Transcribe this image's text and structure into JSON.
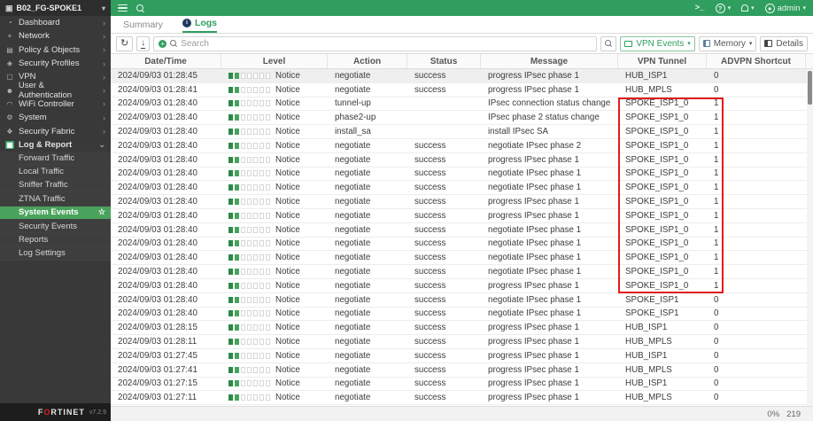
{
  "device": {
    "name": "B02_FG-SPOKE1"
  },
  "navbar": {
    "username": "admin",
    "help_icon": "?",
    "cli_icon": ">_"
  },
  "sidebar": {
    "items": [
      {
        "label": "Dashboard",
        "icon": "gauge-icon"
      },
      {
        "label": "Network",
        "icon": "network-icon"
      },
      {
        "label": "Policy & Objects",
        "icon": "policy-icon"
      },
      {
        "label": "Security Profiles",
        "icon": "shield-icon"
      },
      {
        "label": "VPN",
        "icon": "monitor-icon"
      },
      {
        "label": "User & Authentication",
        "icon": "user-icon"
      },
      {
        "label": "WiFi Controller",
        "icon": "wifi-icon"
      },
      {
        "label": "System",
        "icon": "gear-icon"
      },
      {
        "label": "Security Fabric",
        "icon": "fabric-icon"
      },
      {
        "label": "Log & Report",
        "icon": "chart-icon",
        "expanded": true
      }
    ],
    "log_report_children": [
      "Forward Traffic",
      "Local Traffic",
      "Sniffer Traffic",
      "ZTNA Traffic",
      "System Events",
      "Security Events",
      "Reports",
      "Log Settings"
    ],
    "selected_child": "System Events",
    "footer": {
      "brand_prefix": "F",
      "brand_o": "O",
      "brand_suffix": "RTINET",
      "version": "v7.2.9"
    }
  },
  "tabs": {
    "summary": "Summary",
    "logs": "Logs"
  },
  "toolbar": {
    "search_placeholder": "Search",
    "vpn_events_label": "VPN Events",
    "memory_label": "Memory",
    "details_label": "Details"
  },
  "table": {
    "columns": [
      "Date/Time",
      "Level",
      "Action",
      "Status",
      "Message",
      "VPN Tunnel",
      "ADVPN Shortcut"
    ],
    "level_segments_total": 7,
    "level_segments_filled": 2,
    "rows": [
      [
        "2024/09/03 01:28:45",
        "Notice",
        "negotiate",
        "success",
        "progress IPsec phase 1",
        "HUB_ISP1",
        "0"
      ],
      [
        "2024/09/03 01:28:41",
        "Notice",
        "negotiate",
        "success",
        "progress IPsec phase 1",
        "HUB_MPLS",
        "0"
      ],
      [
        "2024/09/03 01:28:40",
        "Notice",
        "tunnel-up",
        "",
        "IPsec connection status change",
        "SPOKE_ISP1_0",
        "1"
      ],
      [
        "2024/09/03 01:28:40",
        "Notice",
        "phase2-up",
        "",
        "IPsec phase 2 status change",
        "SPOKE_ISP1_0",
        "1"
      ],
      [
        "2024/09/03 01:28:40",
        "Notice",
        "install_sa",
        "",
        "install IPsec SA",
        "SPOKE_ISP1_0",
        "1"
      ],
      [
        "2024/09/03 01:28:40",
        "Notice",
        "negotiate",
        "success",
        "negotiate IPsec phase 2",
        "SPOKE_ISP1_0",
        "1"
      ],
      [
        "2024/09/03 01:28:40",
        "Notice",
        "negotiate",
        "success",
        "progress IPsec phase 1",
        "SPOKE_ISP1_0",
        "1"
      ],
      [
        "2024/09/03 01:28:40",
        "Notice",
        "negotiate",
        "success",
        "negotiate IPsec phase 1",
        "SPOKE_ISP1_0",
        "1"
      ],
      [
        "2024/09/03 01:28:40",
        "Notice",
        "negotiate",
        "success",
        "negotiate IPsec phase 1",
        "SPOKE_ISP1_0",
        "1"
      ],
      [
        "2024/09/03 01:28:40",
        "Notice",
        "negotiate",
        "success",
        "progress IPsec phase 1",
        "SPOKE_ISP1_0",
        "1"
      ],
      [
        "2024/09/03 01:28:40",
        "Notice",
        "negotiate",
        "success",
        "progress IPsec phase 1",
        "SPOKE_ISP1_0",
        "1"
      ],
      [
        "2024/09/03 01:28:40",
        "Notice",
        "negotiate",
        "success",
        "negotiate IPsec phase 1",
        "SPOKE_ISP1_0",
        "1"
      ],
      [
        "2024/09/03 01:28:40",
        "Notice",
        "negotiate",
        "success",
        "negotiate IPsec phase 1",
        "SPOKE_ISP1_0",
        "1"
      ],
      [
        "2024/09/03 01:28:40",
        "Notice",
        "negotiate",
        "success",
        "negotiate IPsec phase 1",
        "SPOKE_ISP1_0",
        "1"
      ],
      [
        "2024/09/03 01:28:40",
        "Notice",
        "negotiate",
        "success",
        "negotiate IPsec phase 1",
        "SPOKE_ISP1_0",
        "1"
      ],
      [
        "2024/09/03 01:28:40",
        "Notice",
        "negotiate",
        "success",
        "progress IPsec phase 1",
        "SPOKE_ISP1_0",
        "1"
      ],
      [
        "2024/09/03 01:28:40",
        "Notice",
        "negotiate",
        "success",
        "negotiate IPsec phase 1",
        "SPOKE_ISP1",
        "0"
      ],
      [
        "2024/09/03 01:28:40",
        "Notice",
        "negotiate",
        "success",
        "negotiate IPsec phase 1",
        "SPOKE_ISP1",
        "0"
      ],
      [
        "2024/09/03 01:28:15",
        "Notice",
        "negotiate",
        "success",
        "progress IPsec phase 1",
        "HUB_ISP1",
        "0"
      ],
      [
        "2024/09/03 01:28:11",
        "Notice",
        "negotiate",
        "success",
        "progress IPsec phase 1",
        "HUB_MPLS",
        "0"
      ],
      [
        "2024/09/03 01:27:45",
        "Notice",
        "negotiate",
        "success",
        "progress IPsec phase 1",
        "HUB_ISP1",
        "0"
      ],
      [
        "2024/09/03 01:27:41",
        "Notice",
        "negotiate",
        "success",
        "progress IPsec phase 1",
        "HUB_MPLS",
        "0"
      ],
      [
        "2024/09/03 01:27:15",
        "Notice",
        "negotiate",
        "success",
        "progress IPsec phase 1",
        "HUB_ISP1",
        "0"
      ],
      [
        "2024/09/03 01:27:11",
        "Notice",
        "negotiate",
        "success",
        "progress IPsec phase 1",
        "HUB_MPLS",
        "0"
      ]
    ],
    "highlight": {
      "first_row": 3,
      "last_row": 16,
      "columns": [
        "VPN Tunnel",
        "ADVPN Shortcut"
      ],
      "color": "#e31b1c"
    }
  },
  "statusbar": {
    "progress": "0%",
    "count": "219"
  }
}
